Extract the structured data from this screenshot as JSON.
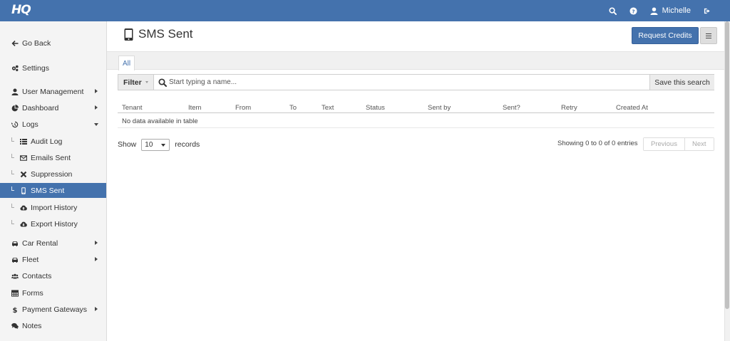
{
  "topbar": {
    "logo": "HQ",
    "user_name": "Michelle",
    "brand_color": "#4472ad"
  },
  "sidebar": {
    "items": [
      {
        "label": "Go Back",
        "icon": "arrow-left-icon"
      },
      {
        "label": "Settings",
        "icon": "gears-icon"
      },
      {
        "label": "User Management",
        "icon": "user-icon"
      },
      {
        "label": "Dashboard",
        "icon": "pie-chart-icon"
      },
      {
        "label": "Logs",
        "icon": "history-icon"
      },
      {
        "label": "Audit Log",
        "icon": "list-icon"
      },
      {
        "label": "Emails Sent",
        "icon": "envelope-icon"
      },
      {
        "label": "Suppression",
        "icon": "times-icon"
      },
      {
        "label": "SMS Sent",
        "icon": "mobile-icon"
      },
      {
        "label": "Import History",
        "icon": "cloud-upload-icon"
      },
      {
        "label": "Export History",
        "icon": "cloud-download-icon"
      },
      {
        "label": "Car Rental",
        "icon": "car-icon"
      },
      {
        "label": "Fleet",
        "icon": "car-icon"
      },
      {
        "label": "Contacts",
        "icon": "users-icon"
      },
      {
        "label": "Forms",
        "icon": "table-icon"
      },
      {
        "label": "Payment Gateways",
        "icon": "dollar-icon"
      },
      {
        "label": "Notes",
        "icon": "comments-icon"
      }
    ]
  },
  "page": {
    "title": "SMS Sent",
    "request_credits_label": "Request Credits",
    "tab_all": "All"
  },
  "filter": {
    "filter_label": "Filter",
    "search_placeholder": "Start typing a name...",
    "save_label": "Save this search"
  },
  "table": {
    "columns": [
      "Tenant",
      "Item",
      "From",
      "To",
      "Text",
      "Status",
      "Sent by",
      "Sent?",
      "Retry",
      "Created At"
    ],
    "empty_text": "No data available in table"
  },
  "footer": {
    "show_label": "Show",
    "page_size": "10",
    "records_label": "records",
    "info": "Showing 0 to 0 of 0 entries",
    "previous_label": "Previous",
    "next_label": "Next"
  }
}
